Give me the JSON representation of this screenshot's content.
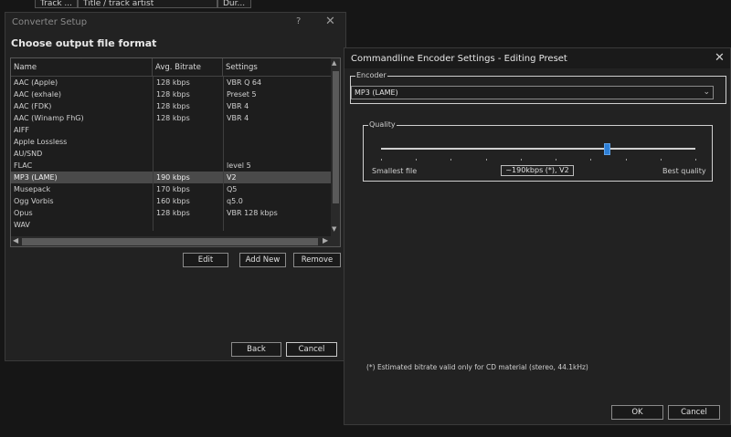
{
  "background_list": {
    "columns": [
      "Track ...",
      "Title / track artist",
      "Dur..."
    ]
  },
  "converter": {
    "title": "Converter Setup",
    "help_glyph": "?",
    "close_glyph": "✕",
    "heading": "Choose output file format",
    "columns": [
      "Name",
      "Avg. Bitrate",
      "Settings"
    ],
    "rows": [
      {
        "name": "AAC (Apple)",
        "bitrate": "128 kbps",
        "settings": "VBR Q 64"
      },
      {
        "name": "AAC (exhale)",
        "bitrate": "128 kbps",
        "settings": "Preset 5"
      },
      {
        "name": "AAC (FDK)",
        "bitrate": "128 kbps",
        "settings": "VBR 4"
      },
      {
        "name": "AAC (Winamp FhG)",
        "bitrate": "128 kbps",
        "settings": "VBR 4"
      },
      {
        "name": "AIFF",
        "bitrate": "",
        "settings": ""
      },
      {
        "name": "Apple Lossless",
        "bitrate": "",
        "settings": ""
      },
      {
        "name": "AU/SND",
        "bitrate": "",
        "settings": ""
      },
      {
        "name": "FLAC",
        "bitrate": "",
        "settings": "level 5"
      },
      {
        "name": "MP3 (LAME)",
        "bitrate": "190 kbps",
        "settings": "V2",
        "selected": true
      },
      {
        "name": "Musepack",
        "bitrate": "170 kbps",
        "settings": "Q5"
      },
      {
        "name": "Ogg Vorbis",
        "bitrate": "160 kbps",
        "settings": "q5.0"
      },
      {
        "name": "Opus",
        "bitrate": "128 kbps",
        "settings": "VBR 128 kbps"
      },
      {
        "name": "WAV",
        "bitrate": "",
        "settings": ""
      }
    ],
    "buttons": {
      "edit": "Edit",
      "add_new": "Add New",
      "remove": "Remove",
      "back": "Back",
      "cancel": "Cancel"
    }
  },
  "encoder_dialog": {
    "title": "Commandline Encoder Settings - Editing Preset",
    "close_glyph": "✕",
    "encoder_group_label": "Encoder",
    "encoder_value": "MP3 (LAME)",
    "quality_group_label": "Quality",
    "slider_value_fraction": 0.72,
    "slider_min_label": "Smallest file",
    "slider_max_label": "Best quality",
    "slider_value_text": "~190kbps (*), V2",
    "note": "(*) Estimated bitrate valid only for CD material (stereo, 44.1kHz)",
    "buttons": {
      "ok": "OK",
      "cancel": "Cancel"
    }
  },
  "colors": {
    "accent": "#2d7fd6",
    "selection": "#4a4a4a",
    "window_bg": "#222222"
  }
}
